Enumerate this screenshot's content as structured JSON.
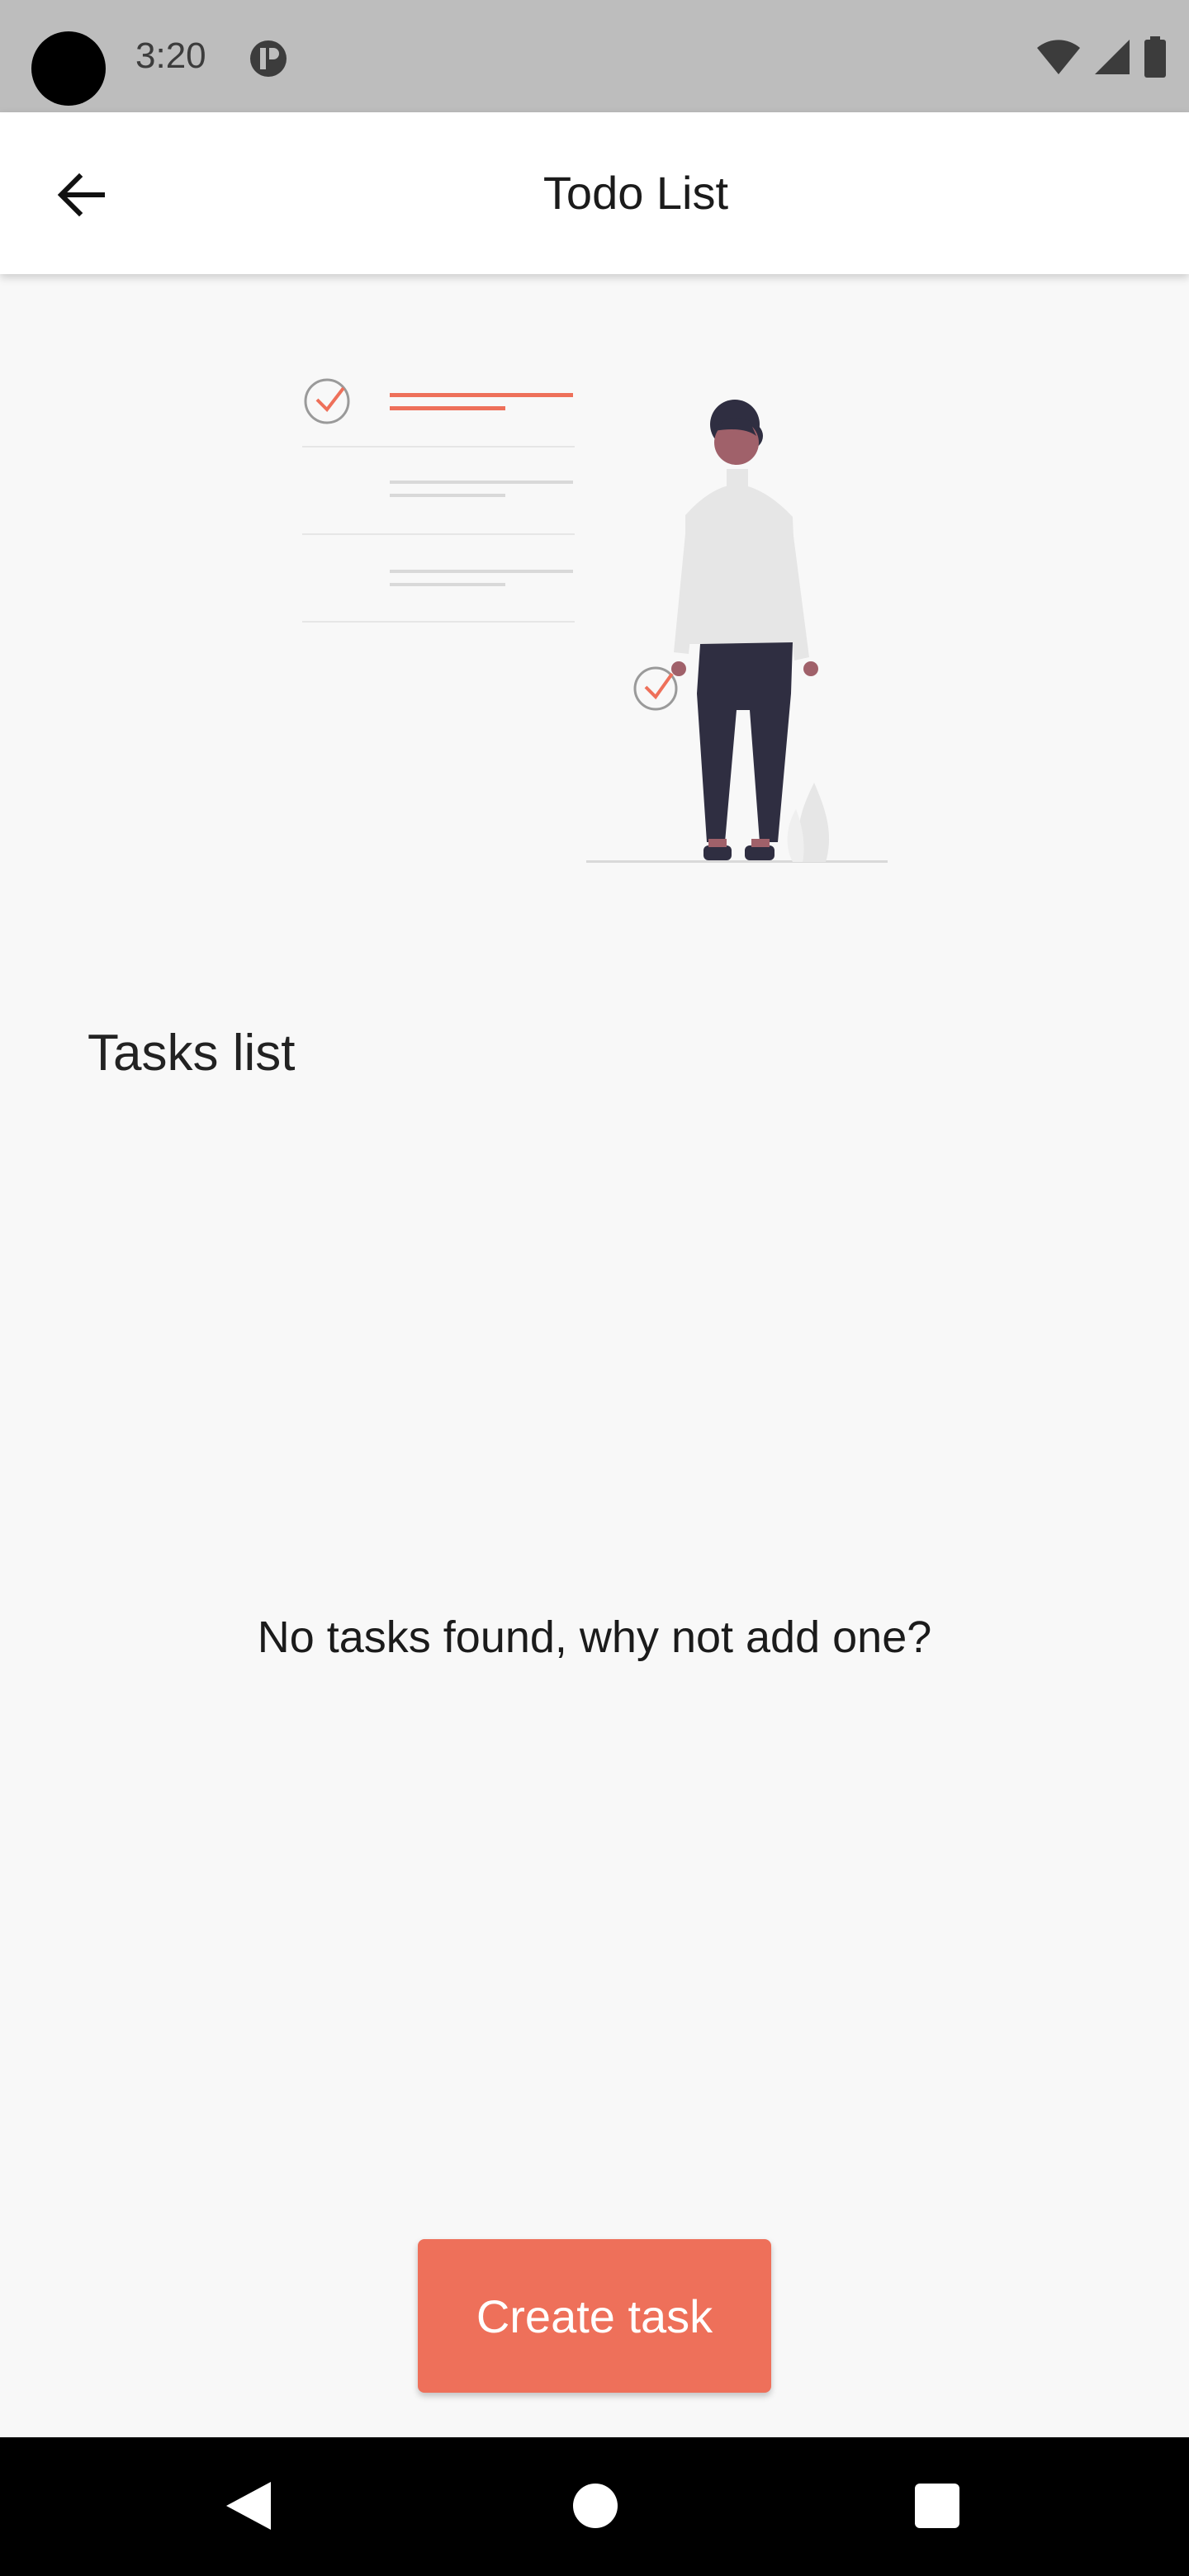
{
  "status_bar": {
    "time": "3:20",
    "icons": [
      "wifi-icon",
      "signal-icon",
      "battery-icon"
    ]
  },
  "app_bar": {
    "title": "Todo List",
    "back_icon": "arrow-left-icon"
  },
  "main": {
    "section_heading": "Tasks list",
    "empty_message": "No tasks found, why not add one?",
    "create_button_label": "Create task"
  },
  "colors": {
    "accent": "#ee705a",
    "background": "#f8f8f8",
    "status_bar": "#bdbdbd",
    "person_top": "#e6e6e6",
    "person_pants": "#2f2e41"
  },
  "nav_bar": {
    "icons": [
      "nav-back-icon",
      "nav-home-icon",
      "nav-recents-icon"
    ]
  }
}
